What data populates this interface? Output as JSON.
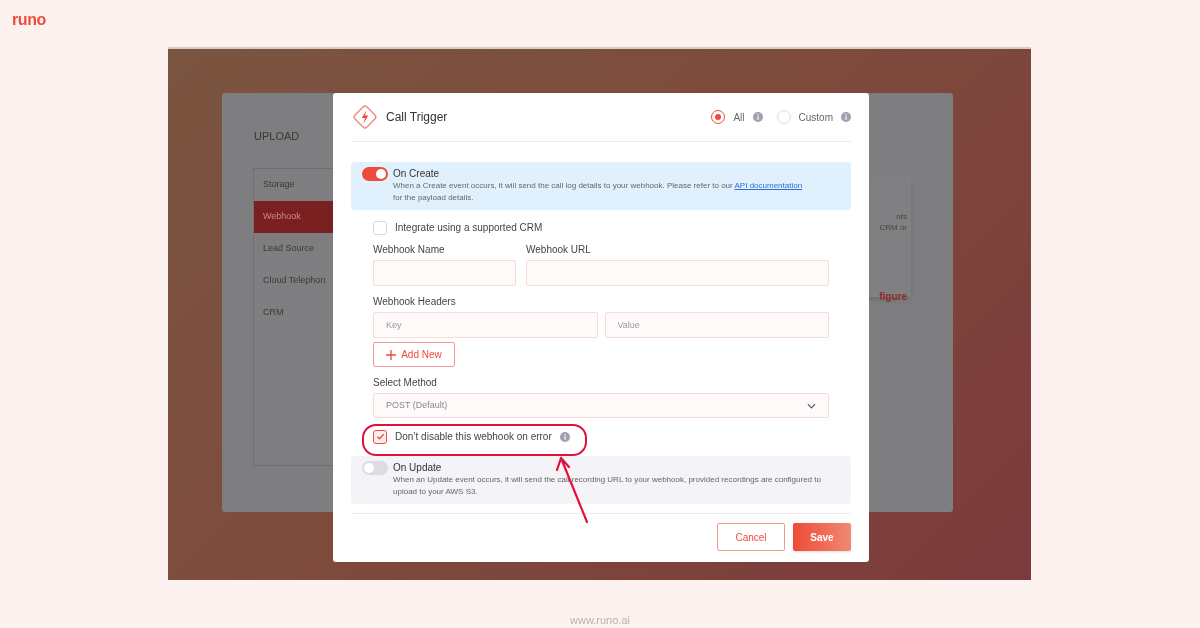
{
  "brand": {
    "logo": "runo"
  },
  "background_app": {
    "tabs": [
      {
        "label": "UPLOAD"
      }
    ],
    "sidebar": {
      "items": [
        {
          "label": "Storage",
          "selected": false
        },
        {
          "label": "Webhook",
          "selected": true
        },
        {
          "label": "Lead Source",
          "selected": false
        },
        {
          "label": "Cloud Telephon",
          "selected": false
        },
        {
          "label": "CRM",
          "selected": false
        }
      ]
    },
    "card": {
      "lines": [
        "nts",
        "CRM or"
      ],
      "link": "figure"
    }
  },
  "dialog": {
    "title": "Call Trigger",
    "scope_options": [
      {
        "label": "All",
        "selected": true
      },
      {
        "label": "Custom",
        "selected": false
      }
    ],
    "on_create": {
      "title": "On Create",
      "on": true,
      "description": "When a Create event occurs, it will send the call log details to your webhook. Please refer to our",
      "link": "API documentation",
      "description_end": "for the payload details."
    },
    "form": {
      "crm_checkbox": {
        "label": "Integrate using a supported CRM",
        "checked": false
      },
      "webhook_name": {
        "label": "Webhook Name"
      },
      "webhook_url": {
        "label": "Webhook URL"
      },
      "headers": {
        "label": "Webhook Headers",
        "key_placeholder": "Key",
        "value_placeholder": "Value"
      },
      "add_button": "Add New",
      "method": {
        "label": "Select Method",
        "value": "POST (Default)"
      },
      "error_checkbox": {
        "label": "Don’t disable this webhook on error",
        "checked": true
      }
    },
    "on_update": {
      "title": "On Update",
      "on": false,
      "description": "When an Update event occurs, it will send the call recording URL to your webhook, provided recordings are configured to upload to your AWS S3."
    },
    "buttons": {
      "cancel": "Cancel",
      "save": "Save"
    }
  },
  "footer": {
    "url": "www.runo.ai"
  }
}
